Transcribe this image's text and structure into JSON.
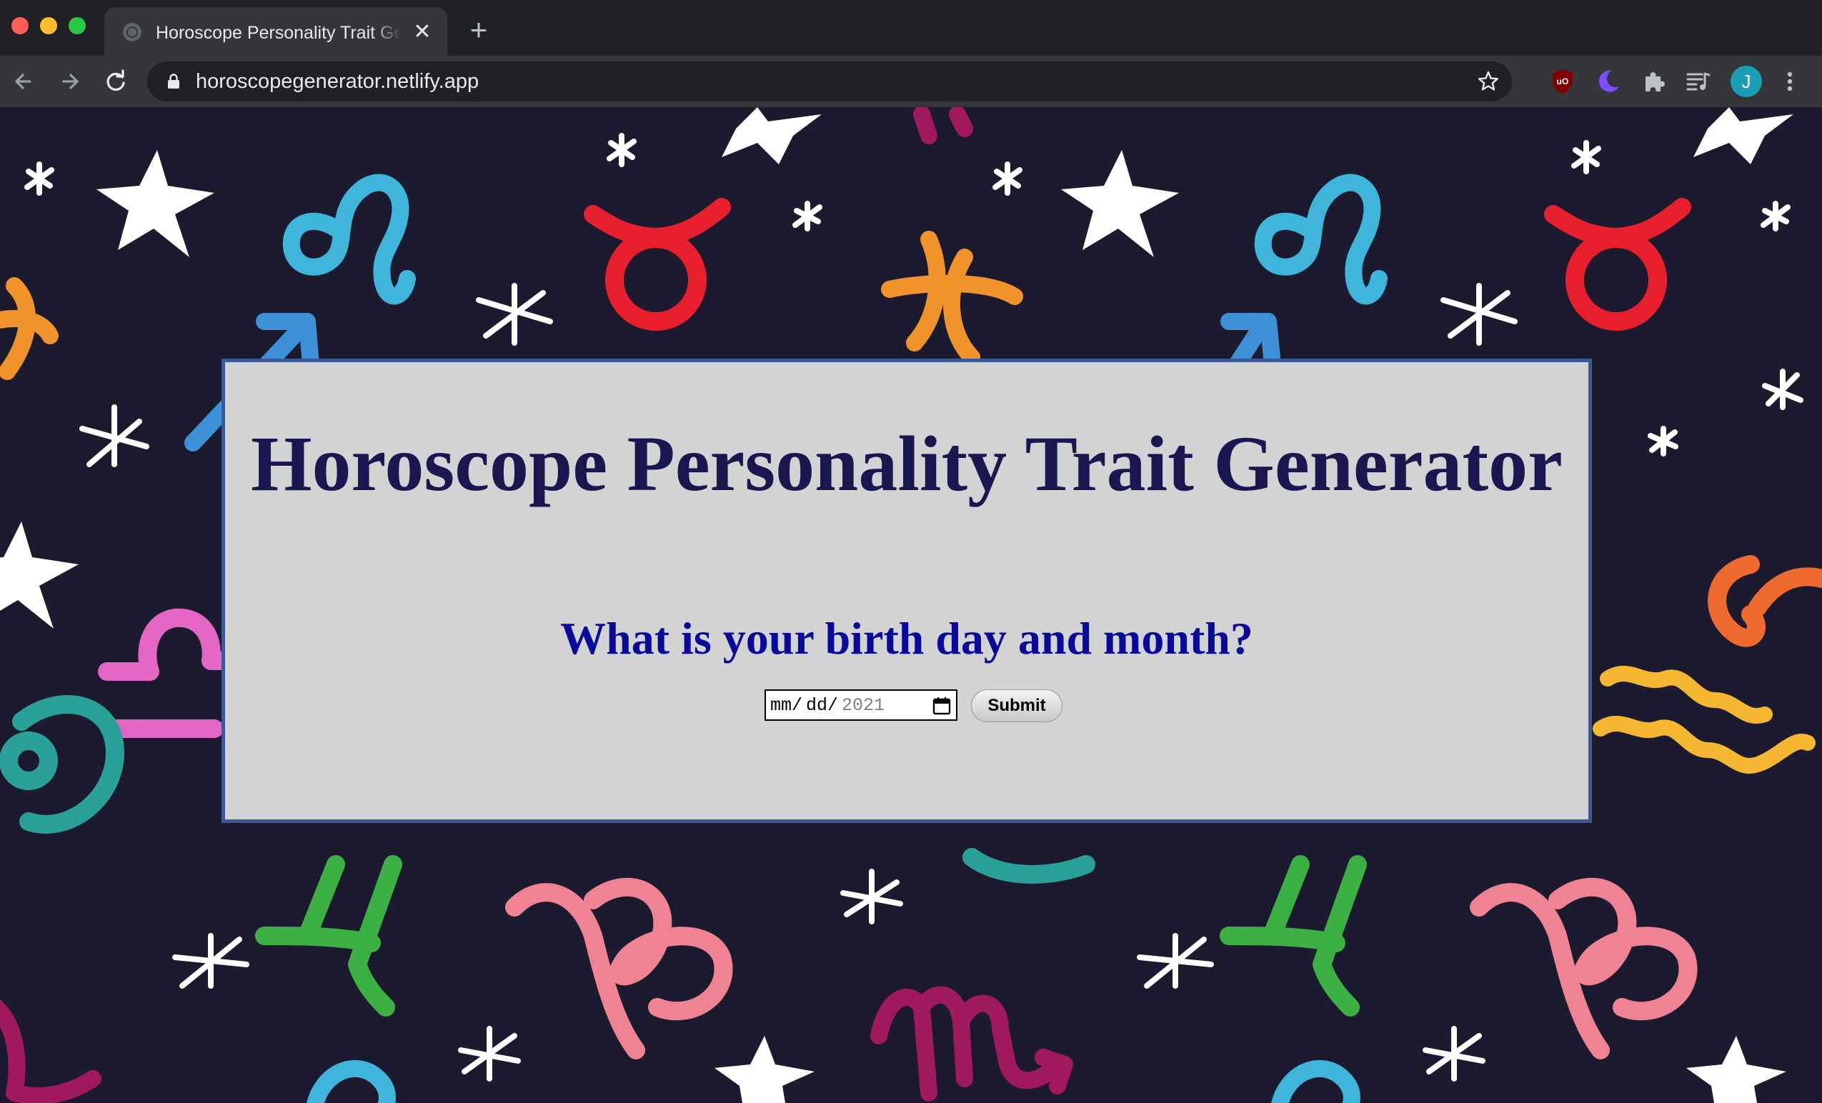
{
  "browser": {
    "tab_title": "Horoscope Personality Trait Generator",
    "tab_close": "✕",
    "new_tab": "+",
    "url": "horoscopegenerator.netlify.app",
    "avatar_initial": "J",
    "icons": [
      "back-icon",
      "forward-icon",
      "reload-icon",
      "lock-icon",
      "star-icon",
      "ublock-icon",
      "moon-icon",
      "puzzle-icon",
      "media-icon",
      "menu-icon"
    ]
  },
  "page": {
    "title": "Horoscope Personality Trait Generator",
    "question": "What is your birth day and month?",
    "date_input": {
      "mm": "mm",
      "dd": "dd",
      "yyyy": "2021"
    },
    "submit_label": "Submit",
    "colors": {
      "background": "#1b1a2e",
      "card": "#d3d3d3",
      "card_border": "#3b5998",
      "title": "#1a1750",
      "question": "#0a0a9a"
    }
  }
}
